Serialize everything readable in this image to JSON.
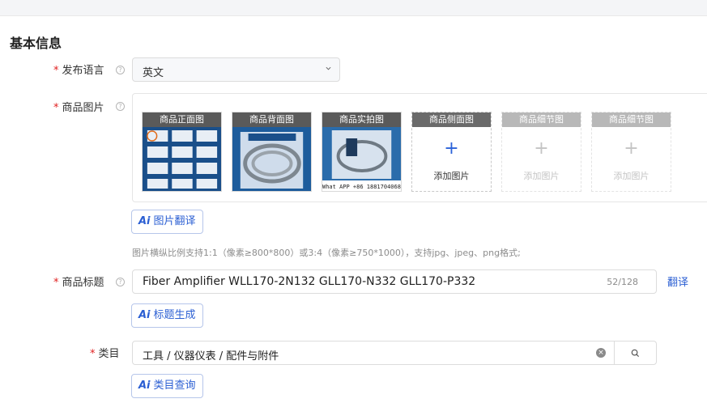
{
  "section": {
    "title": "基本信息"
  },
  "fields": {
    "language": {
      "label": "发布语言",
      "value": "英文"
    },
    "images": {
      "label": "商品图片",
      "slots": [
        {
          "label": "商品正面图",
          "filled": true
        },
        {
          "label": "商品背面图",
          "filled": true
        },
        {
          "label": "商品实拍图",
          "filled": true,
          "caption": "What APP +86 18817040688"
        },
        {
          "label": "商品侧面图",
          "filled": false,
          "add_text": "添加图片",
          "enabled": true
        },
        {
          "label": "商品细节图",
          "filled": false,
          "add_text": "添加图片",
          "enabled": false
        },
        {
          "label": "商品细节图",
          "filled": false,
          "add_text": "添加图片",
          "enabled": false
        }
      ],
      "translate_button": "图片翻译",
      "hint": "图片横纵比例支持1:1（像素≥800*800）或3:4（像素≥750*1000），支持jpg、jpeg、png格式;"
    },
    "title": {
      "label": "商品标题",
      "value": "Fiber Amplifier WLL170-2N132 GLL170-N332 GLL170-P332",
      "count": "52/128",
      "translate_link": "翻译",
      "generate_button": "标题生成"
    },
    "category": {
      "label": "类目",
      "value": "工具 / 仪器仪表 / 配件与附件",
      "query_button": "类目查询"
    }
  },
  "icons": {
    "help": "question-circle-icon",
    "dropdown": "chevron-down-icon",
    "plus": "plus-icon",
    "ai": "ai-sparkle-icon",
    "clear": "clear-circle-icon",
    "search": "search-icon"
  },
  "colors": {
    "accent": "#2b5fd3",
    "required": "#e02020",
    "hint": "#8c8c8c"
  }
}
